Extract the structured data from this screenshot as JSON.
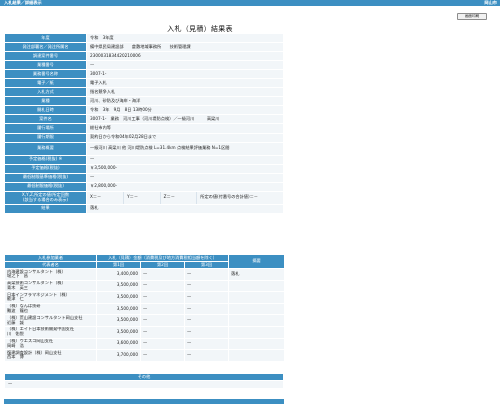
{
  "header": {
    "left": "入札結果／詳細表示",
    "right": "岡山市"
  },
  "print_button": "画面印刷",
  "title": "入札（見積）結果表",
  "info": [
    {
      "label": "年度",
      "value": "令和　3年度"
    },
    {
      "label": "発注部署名／発注所属名",
      "value": "備中県民局建設部　　倉敷地域事務所　　技術管理課"
    },
    {
      "label": "調達案件番号",
      "value": "2300031834420210006"
    },
    {
      "label": "業種番号",
      "value": "—"
    },
    {
      "label": "業務番号名称",
      "value": "3007-1-"
    },
    {
      "label": "電子／紙",
      "value": "電子入札"
    },
    {
      "label": "入札方式",
      "value": "指名競争入札"
    },
    {
      "label": "業種",
      "value": "河川、砂防及び海岸・海洋"
    },
    {
      "label": "開札日時",
      "value": "令和　3年　9月　8日 13時00分"
    },
    {
      "label": "案件名",
      "value": "3007-1-　業務　河川工事（河川堤防点検）／一級河川　　　高梁川"
    },
    {
      "label": "履行場所",
      "value": "総社市内等"
    },
    {
      "label": "履行期限",
      "value": "契約日から令和04年02月28日まで"
    },
    {
      "label": "業務概要",
      "value": "一級河川 高梁川 他 河川堤防点検 L=31.4km 点検結果評価業務 N=1区間"
    },
    {
      "label": "予定価格(税抜) ※",
      "value": "—"
    },
    {
      "label": "予定価格(税抜)",
      "value": "￥3,500,000-"
    },
    {
      "label": "最低制限基準価格(税抜)",
      "value": "—"
    },
    {
      "label": "最低制限価格(税抜)",
      "value": "￥2,800,000-"
    }
  ],
  "score_row": {
    "label_line1": "X,Y,Z,所定の値/所定回数",
    "label_line2": "(該当する場合のみ表示)",
    "cells": [
      "X＝－",
      "Y＝－",
      "Z＝－",
      "所定の値(付番号の合計値)＝－"
    ]
  },
  "result": {
    "label": "結果",
    "value": "落札"
  },
  "bid_table": {
    "col_name": "入札参加業者",
    "col_amount_group": "入札（見積）金額（消費税及び地方消費税相当額を除く）",
    "col_rep": "代表者名",
    "col_round1": "第1回",
    "col_round2": "第2回",
    "col_round3": "第3回",
    "col_note": "摘要",
    "rows": [
      {
        "company": "内海建設コンサルタント（株）",
        "rep": "堀之下　昌",
        "r1": "3,400,000",
        "r2": "—",
        "r3": "—",
        "note": "落札"
      },
      {
        "company": "高梁技術コンサルタント（株）",
        "rep": "青木　英三",
        "r1": "3,500,000",
        "r2": "—",
        "r3": "—",
        "note": ""
      },
      {
        "company": "日本インフラマネジメント（株）",
        "rep": "能津　仁",
        "r1": "3,500,000",
        "r2": "—",
        "r3": "—",
        "note": ""
      },
      {
        "company": "（株）なんば技研",
        "rep": "難波　龍也",
        "r1": "3,500,000",
        "r2": "—",
        "r3": "—",
        "note": ""
      },
      {
        "company": "（株）荒山建設コンサルタント岡山支社",
        "rep": "近藤　誠",
        "r1": "3,500,000",
        "r2": "—",
        "r3": "—",
        "note": ""
      },
      {
        "company": "（株）エイト日本技術開発中国支社",
        "rep": "川　佑悦",
        "r1": "3,500,000",
        "r2": "—",
        "r3": "—",
        "note": ""
      },
      {
        "company": "（株）ウエスコ岡山支社",
        "rep": "岡崎　浩",
        "r1": "3,600,000",
        "r2": "—",
        "r3": "—",
        "note": ""
      },
      {
        "company": "復建調査設計（株）岡山支社",
        "rep": "西本　博",
        "r1": "3,700,000",
        "r2": "—",
        "r3": "—",
        "note": ""
      }
    ]
  },
  "other": {
    "heading": "その他",
    "value": "—"
  }
}
